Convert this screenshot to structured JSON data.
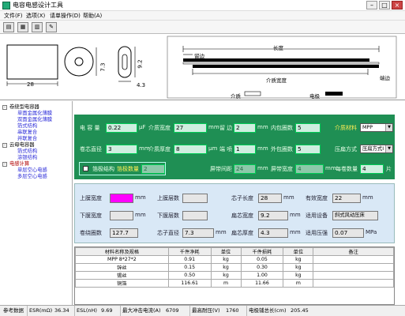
{
  "window": {
    "title": "电容电感设计工具",
    "min": "–",
    "max": "□",
    "close": "×"
  },
  "menu": [
    "文件(F)",
    "选项(X)",
    "请单操作(D)",
    "帮助(A)"
  ],
  "toolbar": {
    "icons": [
      "open-icon",
      "calculator-icon",
      "table-icon",
      "wrench-icon"
    ],
    "labels": [
      "▤",
      "▦",
      "▥",
      "✎"
    ]
  },
  "diagram": {
    "width_label": "28",
    "height_label": "7.3",
    "thick_label": "9.2",
    "small_label": "4.3",
    "length_label": "长度",
    "left_margin_label": "留边",
    "dielectric_width_label": "介质宽度",
    "edge_label": "端边",
    "legend_dielectric": "介质",
    "legend_electrode": "电极"
  },
  "tree": {
    "items": [
      {
        "label": "卷绕型电容器",
        "cls": "",
        "exp": "-"
      },
      {
        "label": "单面金属化薄膜",
        "cls": "c",
        "exp": ""
      },
      {
        "label": "双面金属化薄膜",
        "cls": "c",
        "exp": ""
      },
      {
        "label": "箔式结构",
        "cls": "c",
        "exp": ""
      },
      {
        "label": "串联复合",
        "cls": "c",
        "exp": ""
      },
      {
        "label": "并联复合",
        "cls": "c",
        "exp": ""
      },
      {
        "label": "云母电容器",
        "cls": "",
        "exp": "-"
      },
      {
        "label": "箔式结构",
        "cls": "c",
        "exp": ""
      },
      {
        "label": "涂银结构",
        "cls": "c",
        "exp": ""
      },
      {
        "label": "电感计算",
        "cls": "r",
        "exp": "-"
      },
      {
        "label": "单层空心电感",
        "cls": "c",
        "exp": ""
      },
      {
        "label": "多层空心电感",
        "cls": "c",
        "exp": ""
      }
    ]
  },
  "panel1": {
    "capacitance_label": "电 容 量",
    "capacitance_value": "0.22",
    "capacitance_unit": "μF",
    "dielectric_width_label": "介质宽度",
    "dielectric_width_value": "27",
    "mm1": "mm",
    "margin_label": "留 边 量",
    "margin_value": "2",
    "mm2": "mm",
    "inner_turns_label": "内包圈数",
    "inner_turns_value": "5",
    "material_label": "介质材料",
    "material_value": "MPP",
    "core_dia_label": "卷芯直径",
    "core_dia_value": "3",
    "mm3": "mm",
    "dielectric_thick_label": "介质厚度",
    "dielectric_thick_value": "8",
    "um1": "μm",
    "end_spray_label": "端 喷 量",
    "end_spray_value": "1",
    "mm4": "mm",
    "outer_turns_label": "外包圈数",
    "outer_turns_value": "5",
    "flatten_label": "压扁方式",
    "flatten_value": "压扁方式I",
    "foil_checkbox_label": "箔极结构",
    "foil_layers_label": "箔极数量",
    "foil_layers_value": "2",
    "gap_label": "屏带间距",
    "gap_value": "24",
    "mm5": "mm",
    "shield_width_label": "屏带宽度",
    "shield_width_value": "4",
    "mm6": "mm",
    "layers_per_label": "每卷数量",
    "layers_per_value": "4",
    "layers_unit": "片"
  },
  "panel2": {
    "top_width_label": "上膜宽度",
    "top_width_value": "",
    "mm_a": "mm",
    "top_layers_label": "上膜层数",
    "top_layers_value": "",
    "core_len_label": "芯子长度",
    "core_len_value": "28",
    "mm_b": "mm",
    "eff_width_label": "有效宽度",
    "eff_width_value": "22",
    "mm_c": "mm",
    "bot_width_label": "下膜宽度",
    "bot_width_value": "",
    "mm_d": "mm",
    "bot_layers_label": "下膜层数",
    "bot_layers_value": "",
    "flat_width_label": "扁芯宽度",
    "flat_width_value": "9.2",
    "mm_e": "mm",
    "equipment_label": "适用设备",
    "equipment_value": "斜式风动压床",
    "roll_turns_label": "卷绕圈数",
    "roll_turns_value": "127.7",
    "core_dia_label": "芯子直径",
    "core_dia_value": "7.3",
    "mm_f": "mm",
    "flat_thick_label": "扁芯厚度",
    "flat_thick_value": "4.3",
    "mm_g": "mm",
    "pressure_label": "适用压强",
    "pressure_value": "0.07",
    "pressure_unit": "MPa"
  },
  "table": {
    "headers": [
      "材料名称及规格",
      "千件净耗",
      "单位",
      "千件损耗",
      "单位",
      "备注"
    ],
    "rows": [
      [
        "MPP 8*27*2",
        "0.91",
        "kg",
        "0.05",
        "kg",
        ""
      ],
      [
        "锌丝",
        "0.15",
        "kg",
        "0.30",
        "kg",
        ""
      ],
      [
        "锡丝",
        "0.50",
        "kg",
        "1.00",
        "kg",
        ""
      ],
      [
        "铜箔",
        "116.61",
        "m",
        "11.66",
        "m",
        ""
      ]
    ]
  },
  "status": {
    "ref_label": "参考数据",
    "esr_label": "ESR(mΩ)",
    "esr_value": "36.34",
    "esl_label": "ESL(nH)",
    "esl_value": "9.69",
    "surge_label": "最大冲击电流(A)",
    "surge_value": "6709",
    "volt_label": "最高耐压(V)",
    "volt_value": "1760",
    "len_label": "电极铺总长(cm)",
    "len_value": "205.45"
  },
  "colors": {
    "panel_green": "#1f8f54",
    "panel_blue": "#d9e8f6",
    "magenta": "#ff00ff"
  }
}
